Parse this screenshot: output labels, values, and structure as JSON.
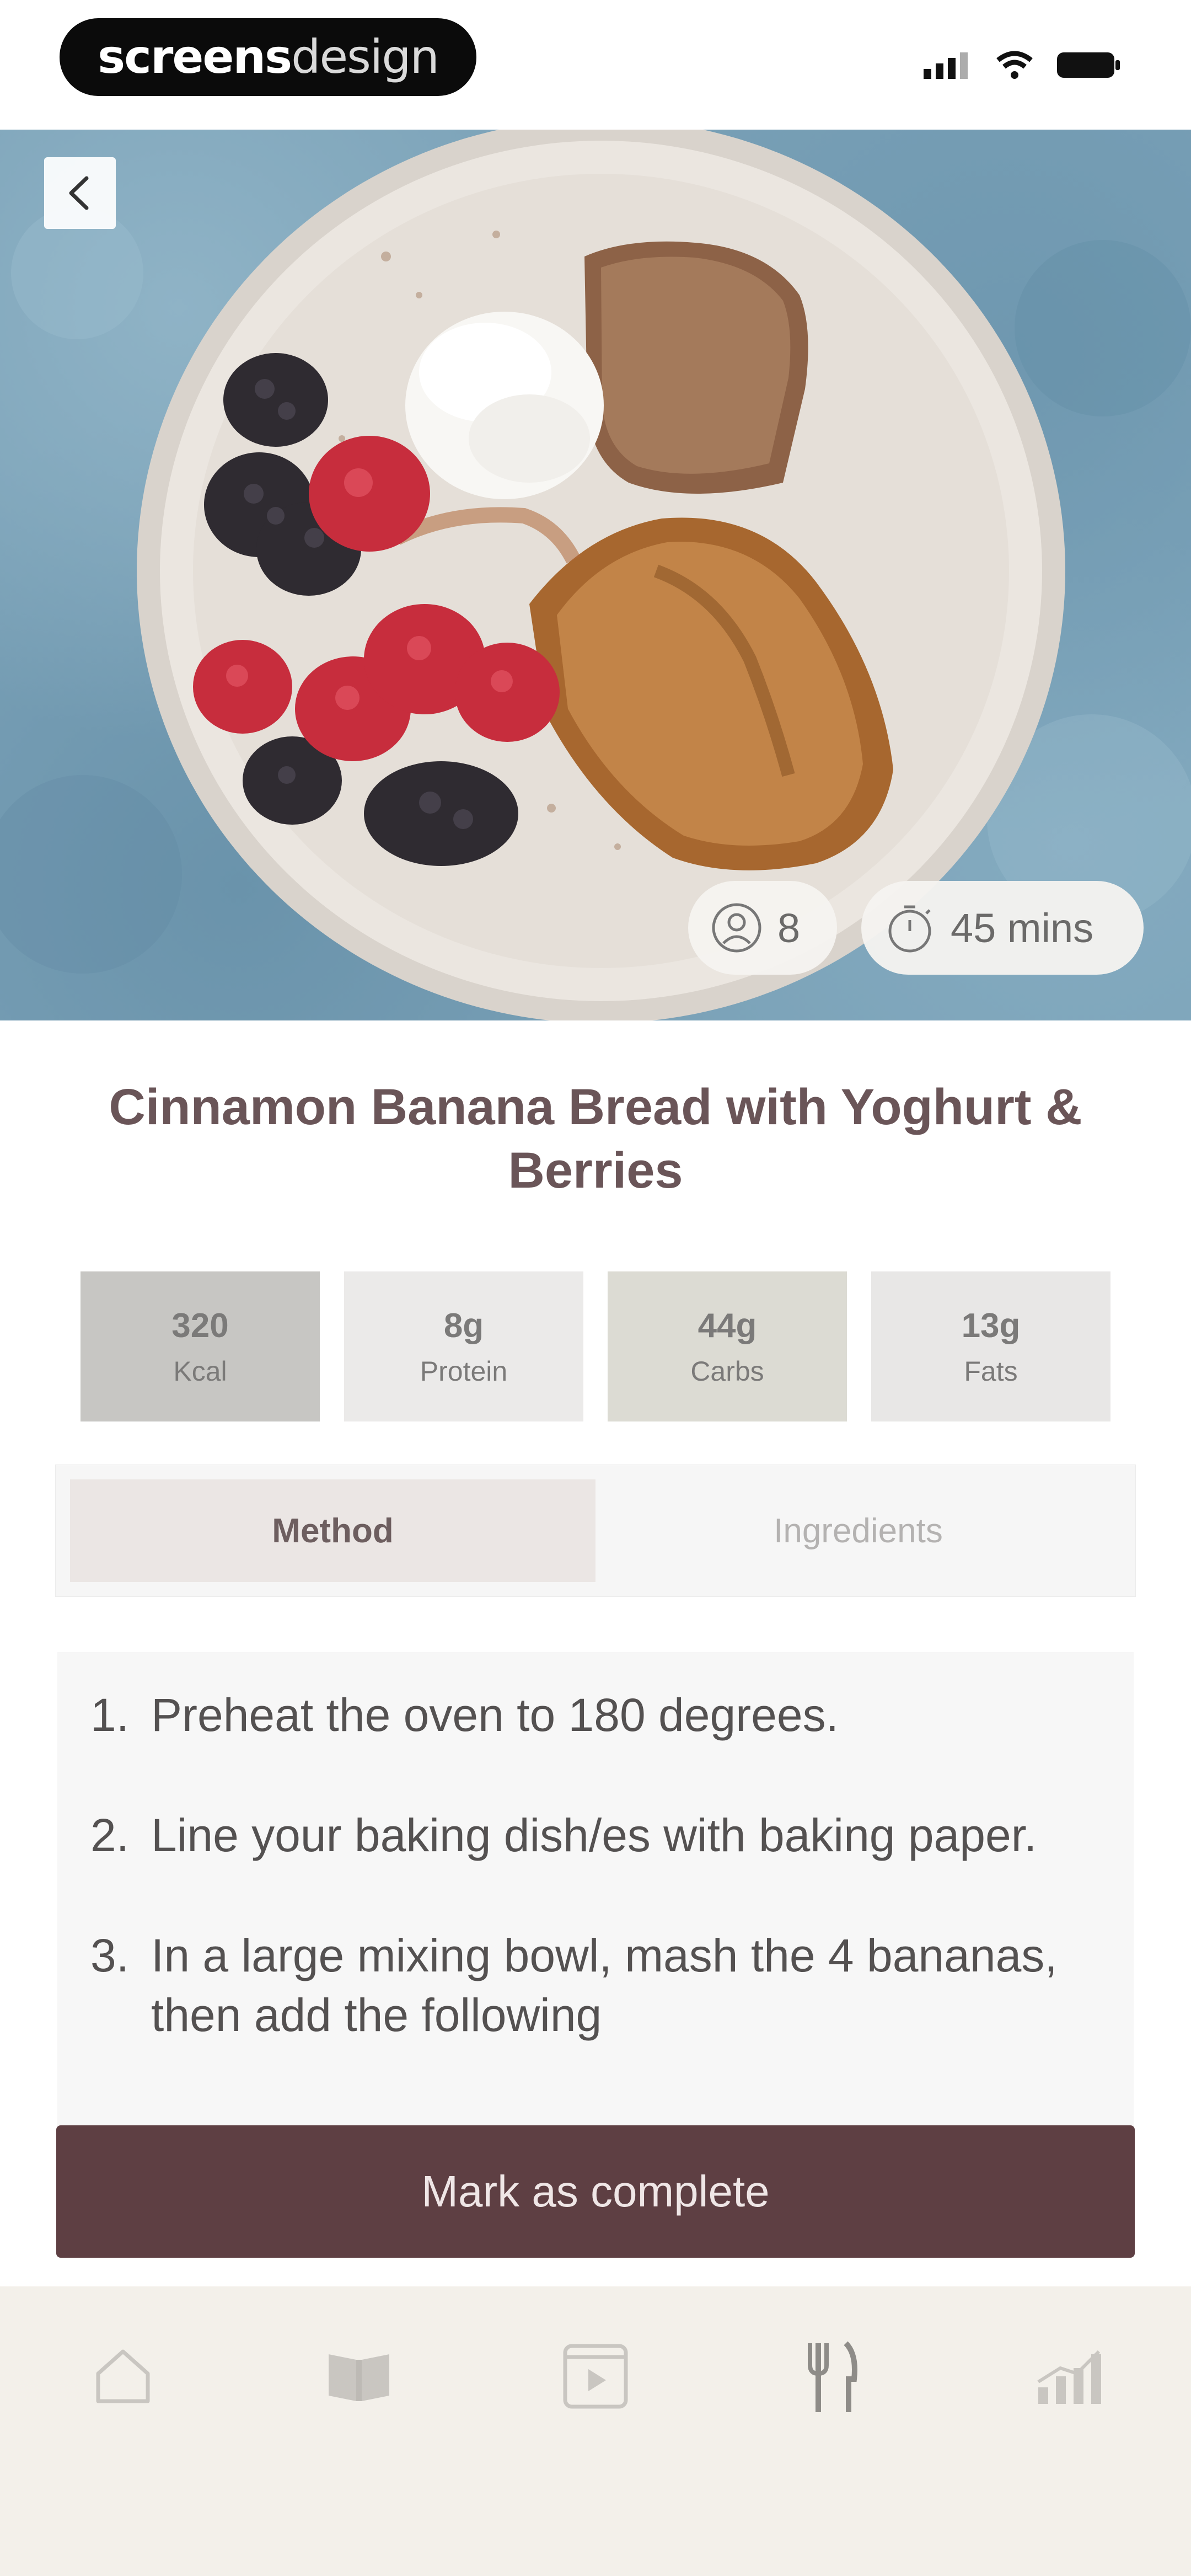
{
  "brand": {
    "label_bold": "screens",
    "label_light": "design"
  },
  "status": {
    "signal_icon": "signal-icon",
    "wifi_icon": "wifi-icon",
    "battery_icon": "battery-icon"
  },
  "hero": {
    "servings": "8",
    "time": "45 mins",
    "back_icon": "chevron-left-icon"
  },
  "recipe": {
    "title": "Cinnamon Banana Bread with Yoghurt & Berries"
  },
  "macros": [
    {
      "value": "320",
      "label": "Kcal"
    },
    {
      "value": "8g",
      "label": "Protein"
    },
    {
      "value": "44g",
      "label": "Carbs"
    },
    {
      "value": "13g",
      "label": "Fats"
    }
  ],
  "tabs": {
    "method": "Method",
    "ingredients": "Ingredients",
    "active": "Method"
  },
  "method": {
    "steps": [
      {
        "num": "1.",
        "text": "Preheat the oven to 180 degrees."
      },
      {
        "num": "2.",
        "text": "Line your baking dish/es with baking paper."
      },
      {
        "num": "3.",
        "text": "In a large mixing bowl, mash the 4 bananas, then add the following"
      }
    ]
  },
  "cta": {
    "label": "Mark as complete"
  },
  "colors": {
    "accent": "#5e3f43",
    "title": "#6a5558",
    "tabbar_bg": "#f3f0ea"
  },
  "nav": [
    {
      "icon": "home-icon"
    },
    {
      "icon": "book-icon"
    },
    {
      "icon": "video-icon"
    },
    {
      "icon": "fork-knife-icon"
    },
    {
      "icon": "chart-icon"
    }
  ]
}
